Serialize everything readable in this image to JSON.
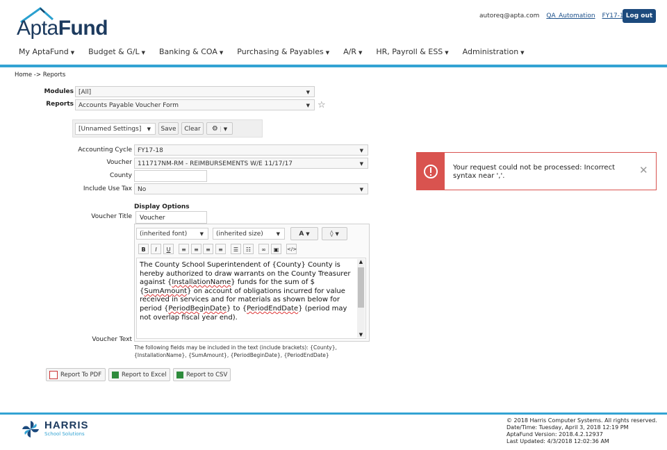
{
  "brand": {
    "name_light": "Apta",
    "name_bold": "Fund"
  },
  "top": {
    "email": "autoreq@apta.com",
    "user": "QA_Automation",
    "fy": "FY17-18",
    "logout": "Log out"
  },
  "nav": [
    "My AptaFund",
    "Budget & G/L",
    "Banking & COA",
    "Purchasing & Payables",
    "A/R",
    "HR, Payroll & ESS",
    "Administration"
  ],
  "breadcrumb": "Home -> Reports",
  "form": {
    "modules_label": "Modules",
    "modules_value": "[All]",
    "reports_label": "Reports",
    "reports_value": "Accounts Payable Voucher Form",
    "settings_value": "[Unnamed Settings]",
    "save": "Save",
    "clear": "Clear",
    "cycle_label": "Accounting Cycle",
    "cycle_value": "FY17-18",
    "voucher_label": "Voucher",
    "voucher_value": "111717NM-RM - REIMBURSEMENTS W/E 11/17/17",
    "county_label": "County",
    "county_value": "",
    "usetax_label": "Include Use Tax",
    "usetax_value": "No",
    "display_options": "Display Options",
    "vtitle_label": "Voucher Title",
    "vtitle_value": "Voucher",
    "font_value": "(inherited font)",
    "size_value": "(inherited size)",
    "vtext_label": "Voucher Text",
    "editor": {
      "p1": "The County School Superintendent of {County} County is hereby authorized to draw warrants on the County Treasurer against {",
      "w1": "InstallationName",
      "p2": "} funds for the sum of $ {",
      "w2": "SumAmount",
      "p3": "} on account of obligations incurred for value received in services and for materials as shown below for period {",
      "w3": "PeriodBeginDate",
      "p4": "} to {",
      "w4": "PeriodEndDate",
      "p5": "} (period may not overlap fiscal year end)."
    },
    "hint_line1": "The following fields may be included in the text (include brackets): {County},",
    "hint_line2": "{InstallationName}, {SumAmount}, {PeriodBeginDate}, {PeriodEndDate}"
  },
  "exports": {
    "pdf": "Report To PDF",
    "excel": "Report to Excel",
    "csv": "Report to CSV"
  },
  "alert": {
    "message": "Your request could not be processed: Incorrect syntax near ','."
  },
  "footer": {
    "company": "HARRIS",
    "sub": "School Solutions",
    "copyright": "© 2018 Harris Computer Systems. All rights reserved.",
    "datetime": "Date/Time: Tuesday, April 3, 2018 12:19 PM",
    "version": "AptaFund Version: 2018.4.2.12937",
    "updated": "Last Updated: 4/3/2018 12:02:36 AM"
  },
  "colors": {
    "accent": "#33a3d3",
    "navy": "#1c4a7d",
    "error": "#d9534f"
  }
}
